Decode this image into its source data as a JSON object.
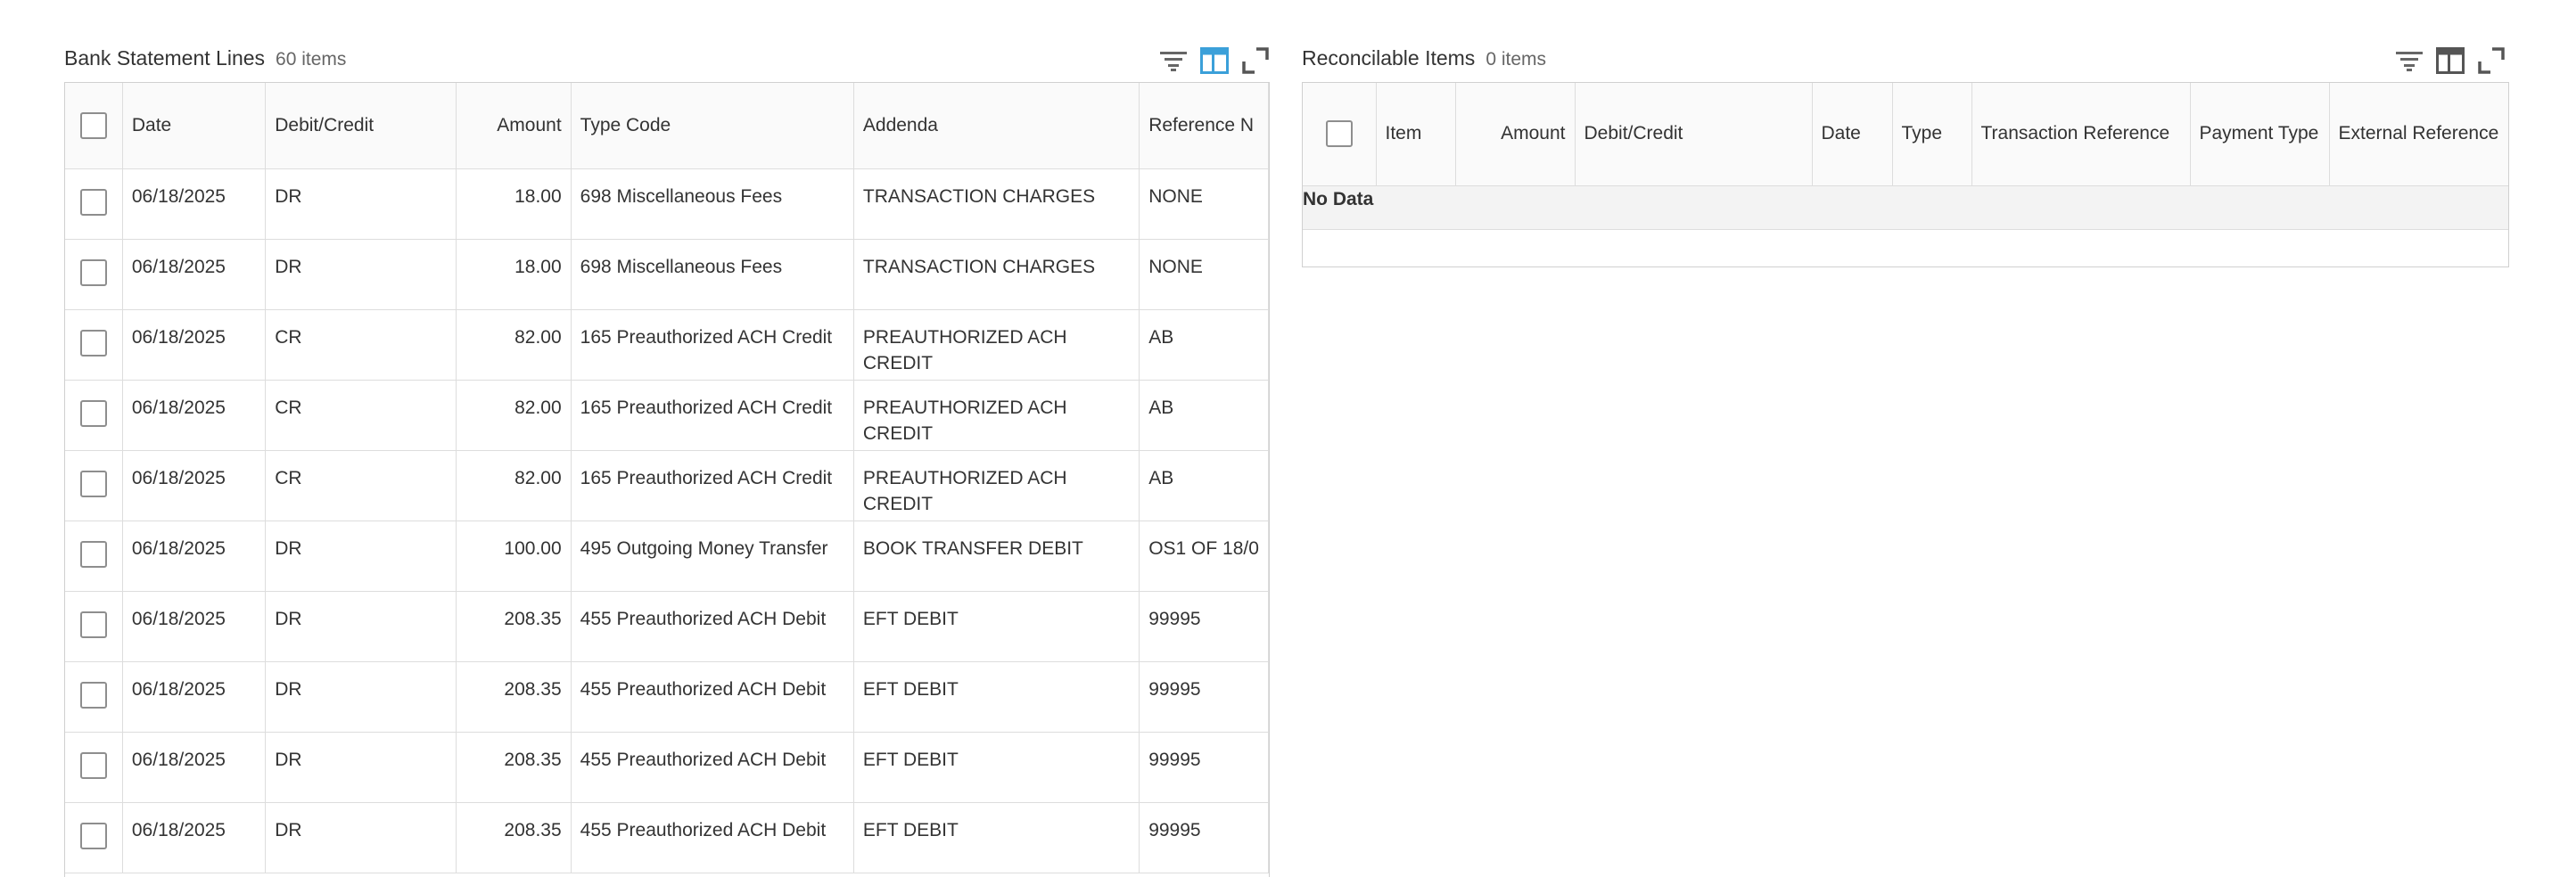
{
  "left_panel": {
    "title": "Bank Statement Lines",
    "count": "60 items",
    "icons": [
      "filter-icon",
      "column-layout-icon",
      "expand-icon"
    ],
    "accent_color": "#3ba0d9",
    "columns": [
      "Date",
      "Debit/Credit",
      "Amount",
      "Type Code",
      "Addenda",
      "Reference N"
    ],
    "rows": [
      {
        "date": "06/18/2025",
        "dc": "DR",
        "amount": "18.00",
        "type_code": "698 Miscellaneous Fees",
        "addenda": "TRANSACTION CHARGES",
        "reference": "NONE"
      },
      {
        "date": "06/18/2025",
        "dc": "DR",
        "amount": "18.00",
        "type_code": "698 Miscellaneous Fees",
        "addenda": "TRANSACTION CHARGES",
        "reference": "NONE"
      },
      {
        "date": "06/18/2025",
        "dc": "CR",
        "amount": "82.00",
        "type_code": "165 Preauthorized ACH Credit",
        "addenda": "PREAUTHORIZED ACH CREDIT",
        "reference": "AB"
      },
      {
        "date": "06/18/2025",
        "dc": "CR",
        "amount": "82.00",
        "type_code": "165 Preauthorized ACH Credit",
        "addenda": "PREAUTHORIZED ACH CREDIT",
        "reference": "AB"
      },
      {
        "date": "06/18/2025",
        "dc": "CR",
        "amount": "82.00",
        "type_code": "165 Preauthorized ACH Credit",
        "addenda": "PREAUTHORIZED ACH CREDIT",
        "reference": "AB"
      },
      {
        "date": "06/18/2025",
        "dc": "DR",
        "amount": "100.00",
        "type_code": "495 Outgoing Money Transfer",
        "addenda": "BOOK TRANSFER DEBIT",
        "reference": "OS1 OF 18/0"
      },
      {
        "date": "06/18/2025",
        "dc": "DR",
        "amount": "208.35",
        "type_code": "455 Preauthorized ACH Debit",
        "addenda": "EFT DEBIT",
        "reference": "99995"
      },
      {
        "date": "06/18/2025",
        "dc": "DR",
        "amount": "208.35",
        "type_code": "455 Preauthorized ACH Debit",
        "addenda": "EFT DEBIT",
        "reference": "99995"
      },
      {
        "date": "06/18/2025",
        "dc": "DR",
        "amount": "208.35",
        "type_code": "455 Preauthorized ACH Debit",
        "addenda": "EFT DEBIT",
        "reference": "99995"
      },
      {
        "date": "06/18/2025",
        "dc": "DR",
        "amount": "208.35",
        "type_code": "455 Preauthorized ACH Debit",
        "addenda": "EFT DEBIT",
        "reference": "99995"
      }
    ]
  },
  "right_panel": {
    "title": "Reconcilable Items",
    "count": "0 items",
    "icons": [
      "filter-icon",
      "column-layout-icon",
      "expand-icon"
    ],
    "columns": [
      "Item",
      "Amount",
      "Debit/Credit",
      "Date",
      "Type",
      "Transaction Reference",
      "Payment Type",
      "External Reference"
    ],
    "empty_message": "No Data"
  }
}
